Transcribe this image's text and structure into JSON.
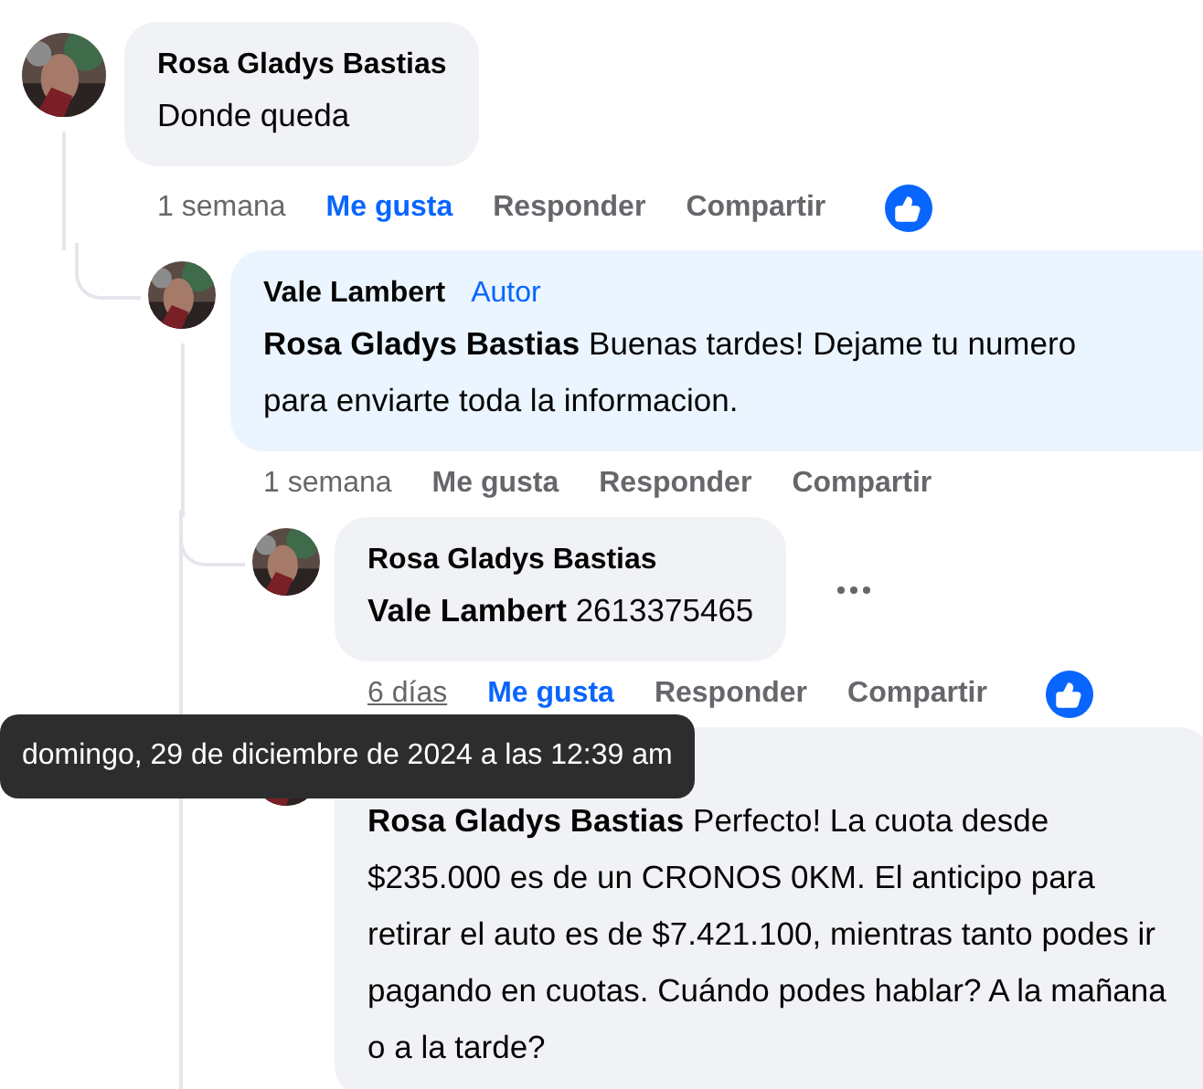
{
  "comments": [
    {
      "author": "Rosa Gladys Bastias",
      "text": "Donde queda",
      "time": "1 semana",
      "time_hovered": false,
      "liked": true,
      "actions": [
        "Me gusta",
        "Responder",
        "Compartir"
      ],
      "reaction": true,
      "children": [
        {
          "author": "Vale Lambert",
          "badge": "Autor",
          "mention": "Rosa Gladys Bastias",
          "text": "Buenas tardes! Dejame tu numero para enviarte toda la informacion.",
          "time": "1 semana",
          "time_hovered": false,
          "liked": false,
          "actions": [
            "Me gusta",
            "Responder",
            "Compartir"
          ],
          "thread_continues": true,
          "children": [
            {
              "author": "Rosa Gladys Bastias",
              "mention": "Vale Lambert",
              "text": "2613375465",
              "time": "6 días",
              "time_hovered": true,
              "liked": true,
              "actions": [
                "Me gusta",
                "Responder",
                "Compartir"
              ],
              "reaction": true,
              "more_menu": true
            },
            {
              "mention": "Rosa Gladys Bastias",
              "text": "Perfecto! La cuota desde $235.000 es de un CRONOS 0KM. El anticipo para retirar el auto es de $7.421.100, mientras tanto podes ir pagando en cuotas. Cuándo podes hablar? A la mañana o a la tarde?"
            }
          ]
        }
      ]
    }
  ],
  "tooltip": "domingo, 29 de diciembre de 2024 a las 12:39 am"
}
